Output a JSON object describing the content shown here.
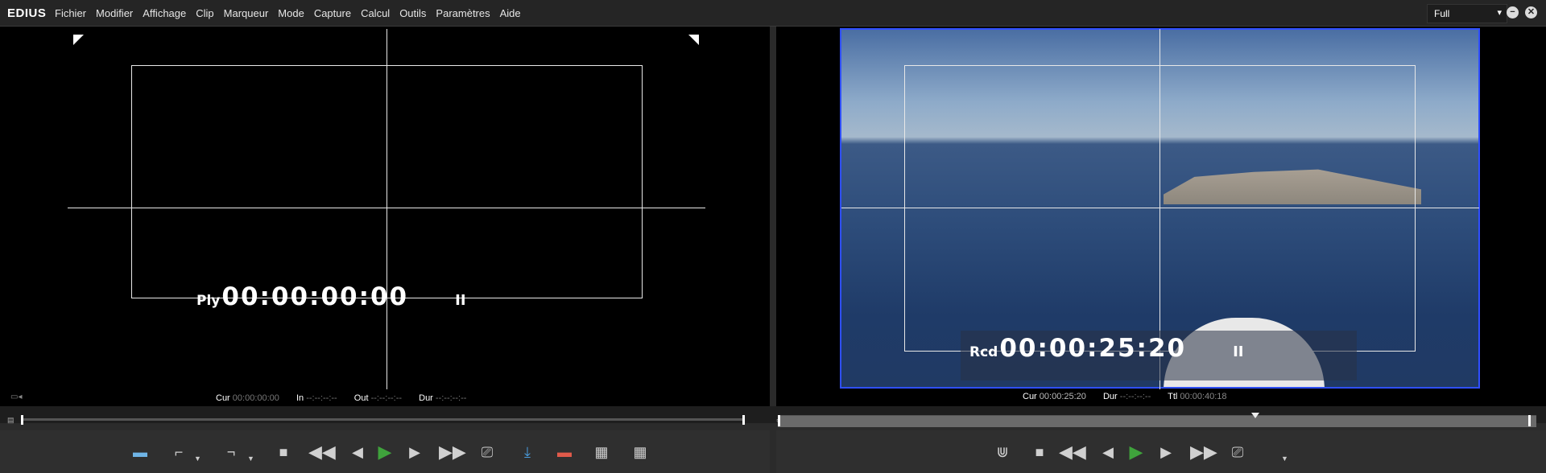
{
  "app": {
    "title": "EDIUS"
  },
  "menu": [
    "Fichier",
    "Modifier",
    "Affichage",
    "Clip",
    "Marqueur",
    "Mode",
    "Capture",
    "Calcul",
    "Outils",
    "Paramètres",
    "Aide"
  ],
  "zoom": {
    "value": "Full"
  },
  "player": {
    "tc_label": "Ply",
    "timecode": "00:00:00:00",
    "pause_glyph": "II",
    "cur_label": "Cur",
    "cur": "00:00:00:00",
    "in_label": "In",
    "in": "--:--:--:--",
    "out_label": "Out",
    "out": "--:--:--:--",
    "dur_label": "Dur",
    "dur": "--:--:--:--"
  },
  "recorder": {
    "tc_label": "Rcd",
    "timecode": "00:00:25:20",
    "pause_glyph": "II",
    "cur_label": "Cur",
    "cur": "00:00:25:20",
    "dur_label": "Dur",
    "dur": "--:--:--:--",
    "ttl_label": "Ttl",
    "ttl": "00:00:40:18",
    "playhead_fraction": 0.63
  },
  "colors": {
    "accent_green": "#3fa33c",
    "frame_blue": "#2f4fff"
  },
  "icons": {
    "player_controls": [
      "clip-display-icon",
      "mark-in-icon",
      "mark-out-icon",
      "stop-icon",
      "rewind-icon",
      "step-back-icon",
      "play-icon",
      "step-forward-icon",
      "fast-forward-icon",
      "loop-icon",
      "insert-to-timeline-icon",
      "overwrite-to-timeline-icon",
      "add-to-bin-icon",
      "add-clip-icon"
    ],
    "recorder_controls": [
      "set-in-out-icon",
      "stop-icon",
      "rewind-icon",
      "step-back-icon",
      "play-icon",
      "step-forward-icon",
      "fast-forward-icon",
      "loop-icon"
    ]
  }
}
